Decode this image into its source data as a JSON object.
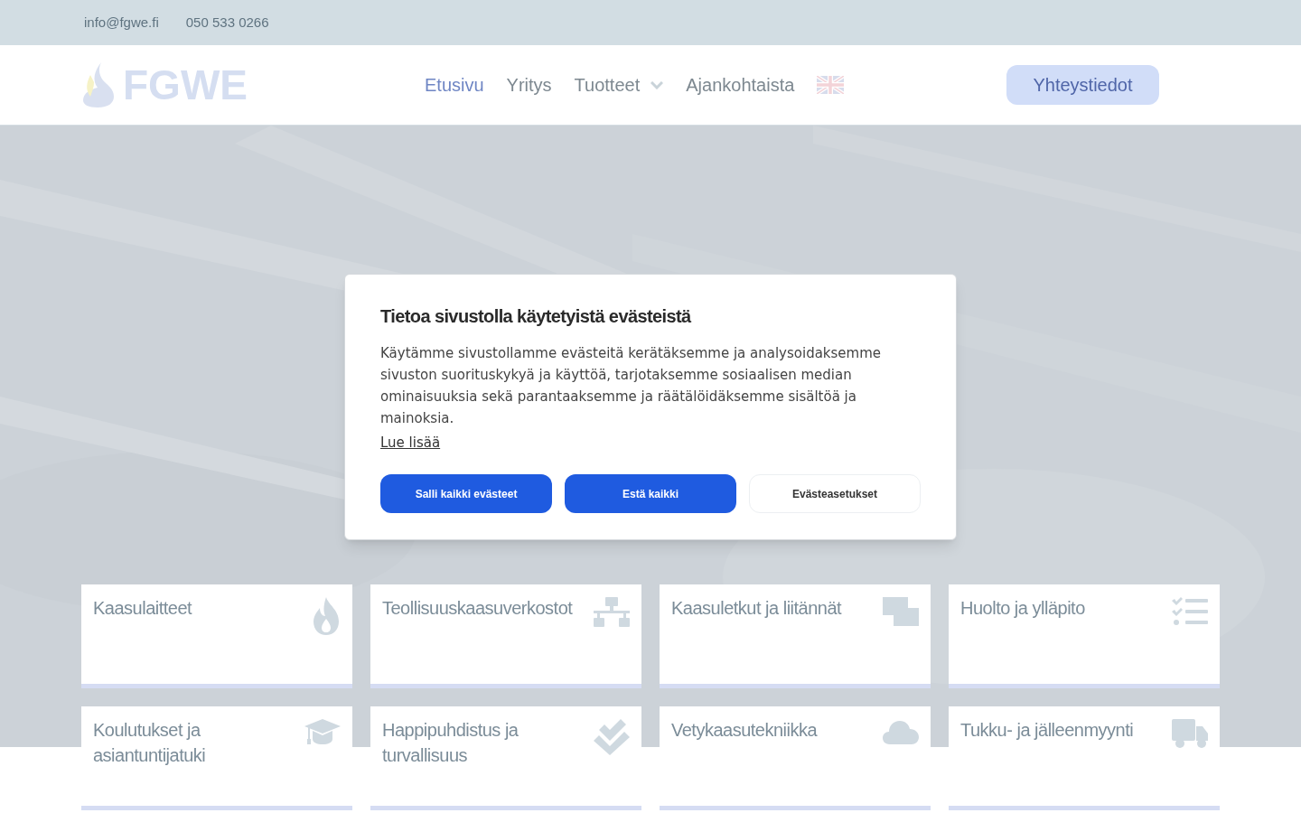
{
  "top_bar": {
    "email": "info@fgwe.fi",
    "phone": "050 533 0266"
  },
  "header": {
    "logo": "FGWE",
    "nav": [
      {
        "label": "Etusivu",
        "selected": true,
        "has_menu": false
      },
      {
        "label": "Yritys",
        "selected": false,
        "has_menu": false
      },
      {
        "label": "Tuotteet",
        "selected": false,
        "has_menu": true
      },
      {
        "label": "Ajankohtaista",
        "selected": false,
        "has_menu": false
      }
    ],
    "contact_button": "Yhteystiedot"
  },
  "services": [
    {
      "title": "Kaasulaitteet"
    },
    {
      "title": "Teollisuuskaasuverkostot"
    },
    {
      "title": "Kaasuletkut ja liitännät"
    },
    {
      "title": "Huolto ja ylläpito"
    },
    {
      "title": "Koulutukset ja asiantuntijatuki"
    },
    {
      "title": "Happipuhdistus ja turvallisuus"
    },
    {
      "title": "Vetykaasutekniikka"
    },
    {
      "title": "Tukku- ja jälleenmyynti"
    }
  ],
  "cookie_dialog": {
    "title": "Tietoa sivustolla käytetyistä evästeistä",
    "text": "Käytämme sivustollamme evästeitä kerätäksemme ja analysoidaksemme sivuston suorituskykyä ja käyttöä, tarjotaksemme sosiaalisen median ominaisuuksia sekä parantaaksemme ja räätälöidäksemme sisältöä ja mainoksia.",
    "link": "Lue lisää",
    "buttons": [
      {
        "label": "Salli kaikki evästeet",
        "kind": "primary"
      },
      {
        "label": "Estä kaikki",
        "kind": "primary"
      },
      {
        "label": "Evästeasetukset",
        "kind": "secondary"
      }
    ]
  }
}
